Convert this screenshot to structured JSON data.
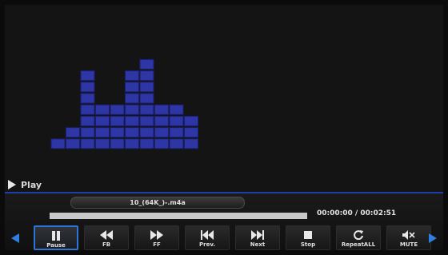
{
  "player": {
    "status_label": "Play",
    "filename": "10_(64K_)-.m4a",
    "time_display": "00:00:00 / 00:02:51",
    "progress_fraction": 1.0
  },
  "visualizer": {
    "bar_levels": [
      1,
      2,
      7,
      4,
      4,
      7,
      8,
      4,
      4,
      3
    ],
    "block_color": "#2e35a5",
    "block_border_color": "#1a1f6e"
  },
  "controls": [
    {
      "id": "pause",
      "label": "Pause",
      "icon": "pause-icon",
      "active": true
    },
    {
      "id": "fb",
      "label": "FB",
      "icon": "fast-backward-icon",
      "active": false
    },
    {
      "id": "ff",
      "label": "FF",
      "icon": "fast-forward-icon",
      "active": false
    },
    {
      "id": "prev",
      "label": "Prev.",
      "icon": "previous-track-icon",
      "active": false
    },
    {
      "id": "next",
      "label": "Next",
      "icon": "next-track-icon",
      "active": false
    },
    {
      "id": "stop",
      "label": "Stop",
      "icon": "stop-icon",
      "active": false
    },
    {
      "id": "repeat",
      "label": "RepeatALL",
      "icon": "repeat-all-icon",
      "active": false
    },
    {
      "id": "mute",
      "label": "MUTE",
      "icon": "mute-icon",
      "active": false
    }
  ],
  "colors": {
    "accent": "#2e74d6",
    "nav_arrow": "#2f7fe3",
    "divider": "#1f3fa8"
  }
}
